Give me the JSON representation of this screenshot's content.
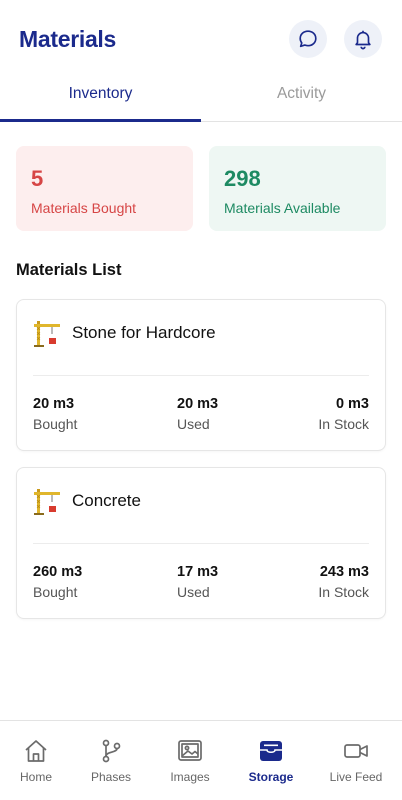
{
  "header": {
    "title": "Materials"
  },
  "tabs": [
    {
      "label": "Inventory",
      "active": true
    },
    {
      "label": "Activity",
      "active": false
    }
  ],
  "stats": {
    "bought": {
      "value": "5",
      "label": "Materials Bought"
    },
    "available": {
      "value": "298",
      "label": "Materials Available"
    }
  },
  "list": {
    "title": "Materials List",
    "items": [
      {
        "name": "Stone for Hardcore",
        "icon": "crane-icon",
        "bought": {
          "value": "20 m3",
          "label": "Bought"
        },
        "used": {
          "value": "20 m3",
          "label": "Used"
        },
        "in_stock": {
          "value": "0 m3",
          "label": "In Stock"
        }
      },
      {
        "name": "Concrete",
        "icon": "crane-icon",
        "bought": {
          "value": "260 m3",
          "label": "Bought"
        },
        "used": {
          "value": "17 m3",
          "label": "Used"
        },
        "in_stock": {
          "value": "243 m3",
          "label": "In Stock"
        }
      }
    ]
  },
  "nav": [
    {
      "label": "Home",
      "icon": "home-icon"
    },
    {
      "label": "Phases",
      "icon": "branch-icon"
    },
    {
      "label": "Images",
      "icon": "images-icon"
    },
    {
      "label": "Storage",
      "icon": "storage-icon",
      "active": true
    },
    {
      "label": "Live Feed",
      "icon": "video-icon"
    }
  ],
  "colors": {
    "primary": "#1b2a8c",
    "bought_text": "#d64545",
    "bought_bg": "#fdeeee",
    "available_text": "#1d8a62",
    "available_bg": "#eef7f3"
  }
}
